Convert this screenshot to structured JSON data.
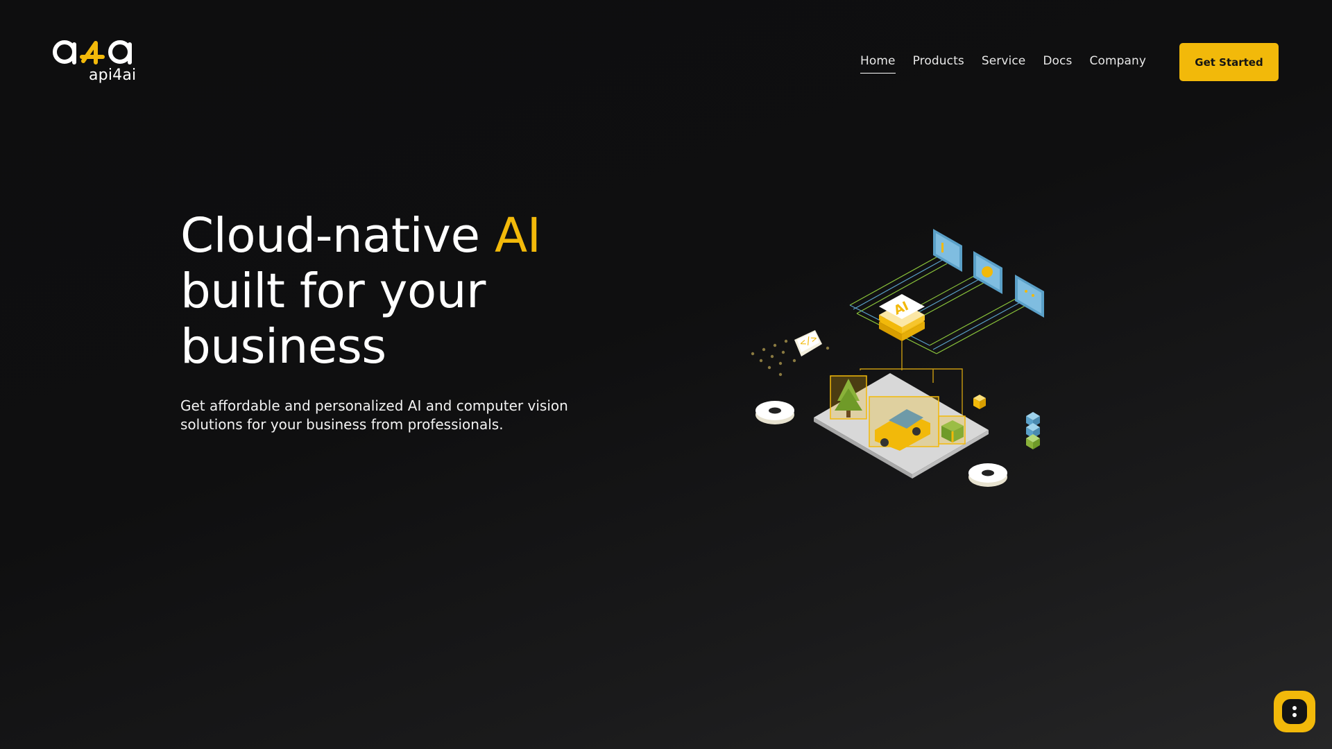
{
  "brand": {
    "logo_text": "a4a",
    "subtitle": "api4ai",
    "accent_color": "#f2b90a"
  },
  "nav": {
    "items": [
      {
        "label": "Home",
        "active": true
      },
      {
        "label": "Products",
        "active": false
      },
      {
        "label": "Service",
        "active": false
      },
      {
        "label": "Docs",
        "active": false
      },
      {
        "label": "Company",
        "active": false
      }
    ]
  },
  "cta": {
    "label": "Get Started"
  },
  "hero": {
    "title_part1": "Cloud-native ",
    "title_accent": "AI",
    "title_part2": "built for your",
    "title_part3": "business",
    "subtitle": "Get affordable and personalized AI and computer vision solutions for your business from professionals."
  },
  "illustration": {
    "chip_label": "AI",
    "code_label": "</>"
  },
  "chat": {
    "icon": "chat-icon"
  }
}
